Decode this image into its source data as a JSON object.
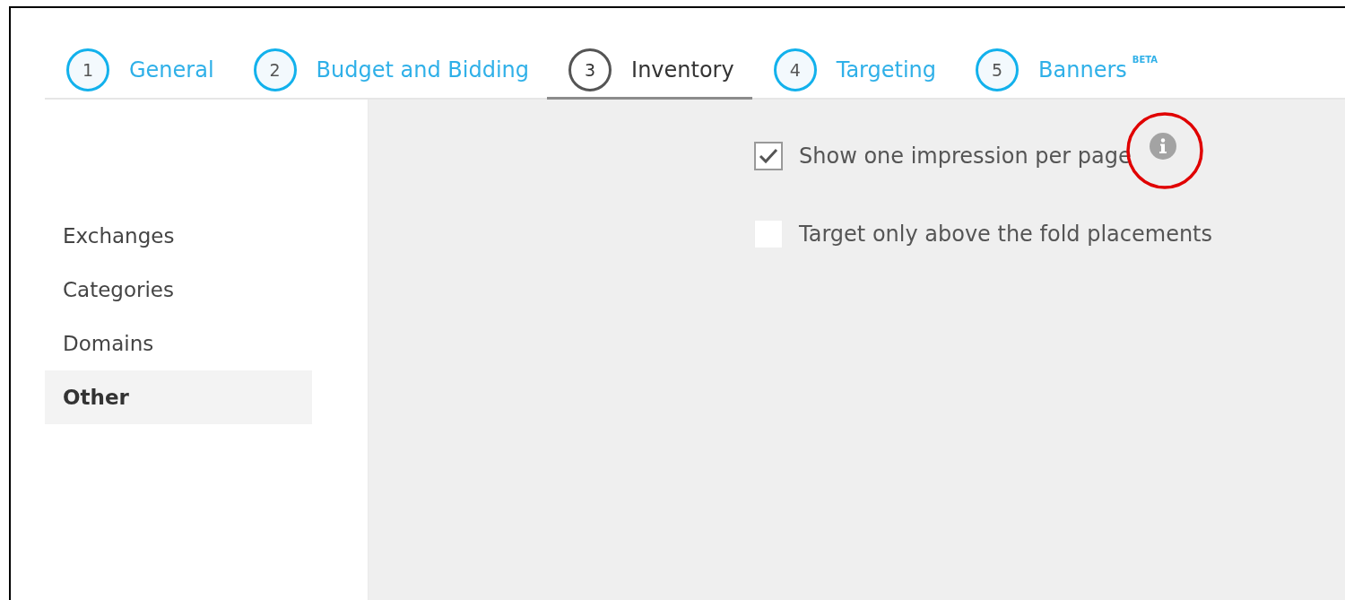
{
  "tabs": [
    {
      "number": "1",
      "label": "General",
      "selected": false
    },
    {
      "number": "2",
      "label": "Budget and Bidding",
      "selected": false
    },
    {
      "number": "3",
      "label": "Inventory",
      "selected": true
    },
    {
      "number": "4",
      "label": "Targeting",
      "selected": false
    },
    {
      "number": "5",
      "label": "Banners",
      "badge": "BETA",
      "selected": false
    }
  ],
  "sidebar": {
    "items": [
      {
        "label": "Exchanges",
        "selected": false
      },
      {
        "label": "Categories",
        "selected": false
      },
      {
        "label": "Domains",
        "selected": false
      },
      {
        "label": "Other",
        "selected": true
      }
    ]
  },
  "options": [
    {
      "label": "Show one impression per page",
      "checked": true,
      "info": true,
      "highlighted": true
    },
    {
      "label": "Target only above the fold placements",
      "checked": false,
      "info": false,
      "highlighted": false
    }
  ]
}
